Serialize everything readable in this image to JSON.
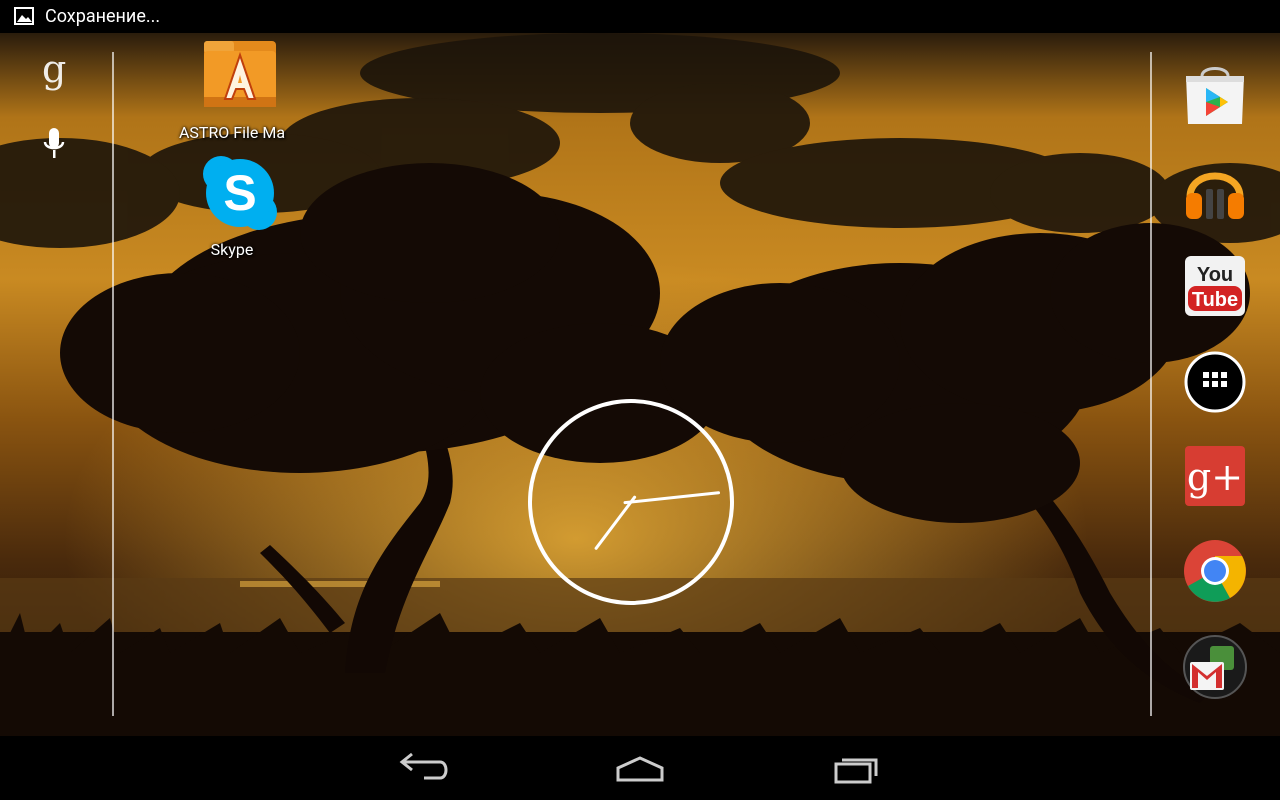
{
  "status_bar": {
    "notification_icon": "image-icon",
    "notification_text": "Сохранение..."
  },
  "search_bar": {
    "google_label": "g",
    "voice_icon": "microphone-icon"
  },
  "desktop": {
    "apps": [
      {
        "label": "ASTRO File Ma",
        "icon": "astro-file-manager-icon"
      },
      {
        "label": "Skype",
        "icon": "skype-icon"
      }
    ]
  },
  "clock": {
    "hour": 7,
    "minute": 14
  },
  "dock": {
    "items": [
      {
        "icon": "play-store-icon"
      },
      {
        "icon": "play-music-icon"
      },
      {
        "icon": "youtube-icon",
        "text_top": "You",
        "text_bottom": "Tube"
      },
      {
        "icon": "all-apps-icon"
      },
      {
        "icon": "google-plus-icon",
        "text": "g+"
      },
      {
        "icon": "chrome-icon"
      },
      {
        "icon": "folder-icon"
      }
    ]
  },
  "nav_bar": {
    "icons": [
      "back-icon",
      "home-icon",
      "recent-apps-icon"
    ]
  },
  "colors": {
    "sky_top": "#3a2a12",
    "sky_glow": "#d8901c",
    "ground": "#1a0e06"
  }
}
